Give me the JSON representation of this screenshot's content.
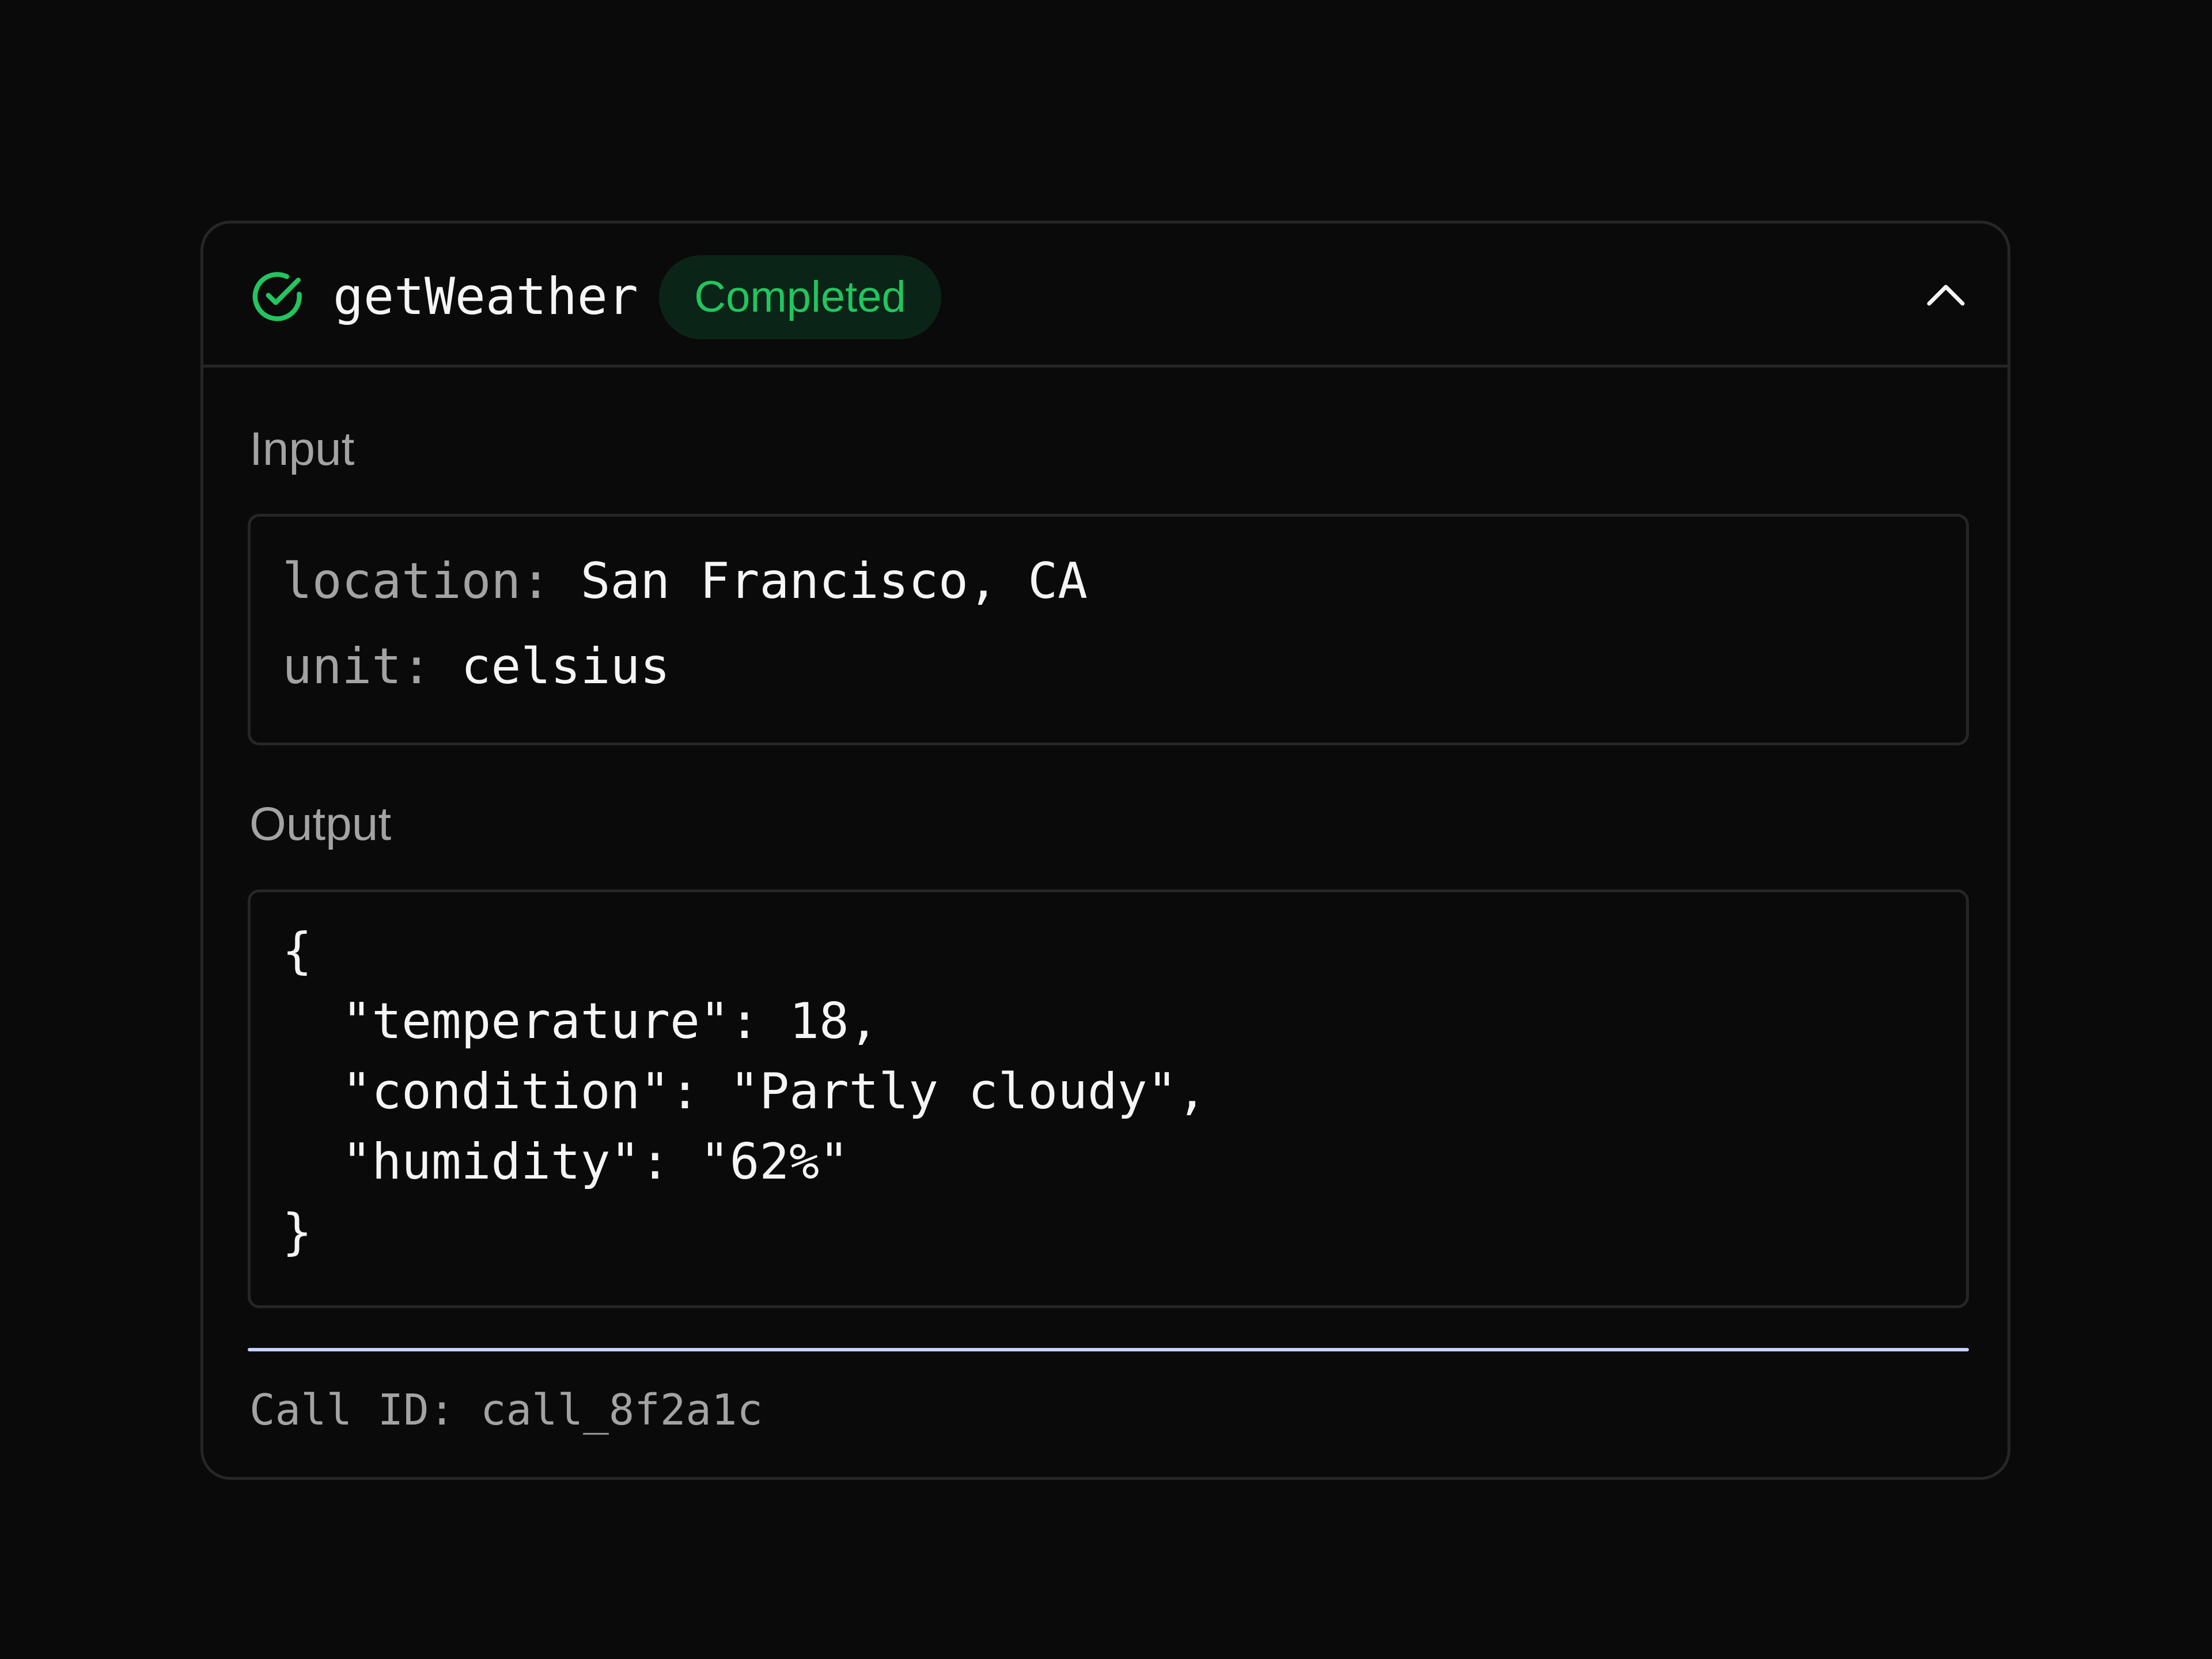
{
  "tool_call": {
    "name": "getWeather",
    "status": "Completed",
    "status_icon": "check-circle-icon",
    "collapse_icon": "chevron-up-icon",
    "colors": {
      "success": "#22c55e",
      "badge_bg": "#0b2418",
      "border": "#262626",
      "divider": "#c7d2fe"
    }
  },
  "input": {
    "label": "Input",
    "params": [
      {
        "key": "location:",
        "value": "San Francisco, CA"
      },
      {
        "key": "unit:",
        "value": "celsius"
      }
    ]
  },
  "output": {
    "label": "Output",
    "lines": [
      "{",
      "  \"temperature\": 18,",
      "  \"condition\": \"Partly cloudy\",",
      "  \"humidity\": \"62%\"",
      "}"
    ]
  },
  "footer": {
    "call_id_label": "Call ID:",
    "call_id": "call_8f2a1c"
  }
}
